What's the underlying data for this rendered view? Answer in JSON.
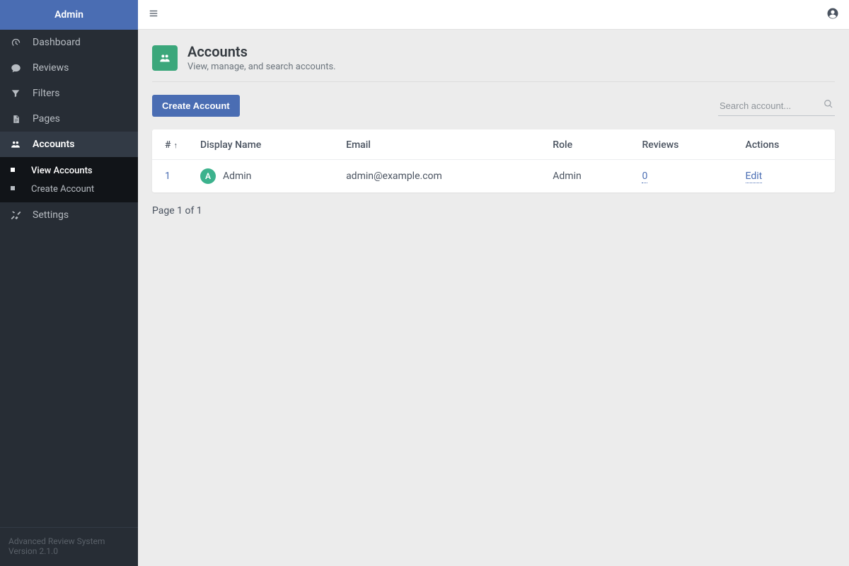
{
  "sidebar": {
    "brand": "Admin",
    "items": [
      {
        "label": "Dashboard"
      },
      {
        "label": "Reviews"
      },
      {
        "label": "Filters"
      },
      {
        "label": "Pages"
      },
      {
        "label": "Accounts"
      },
      {
        "label": "Settings"
      }
    ],
    "sub_accounts": [
      {
        "label": "View Accounts"
      },
      {
        "label": "Create Account"
      }
    ],
    "footer_line1": "Advanced Review System",
    "footer_line2": "Version 2.1.0"
  },
  "page": {
    "title": "Accounts",
    "subtitle": "View, manage, and search accounts.",
    "create_button": "Create Account",
    "search_placeholder": "Search account..."
  },
  "table": {
    "headers": {
      "id": "#",
      "display_name": "Display Name",
      "email": "Email",
      "role": "Role",
      "reviews": "Reviews",
      "actions": "Actions"
    },
    "rows": [
      {
        "id": "1",
        "avatar_letter": "A",
        "display_name": "Admin",
        "email": "admin@example.com",
        "role": "Admin",
        "reviews": "0",
        "action": "Edit"
      }
    ]
  },
  "pagination": "Page 1 of 1"
}
